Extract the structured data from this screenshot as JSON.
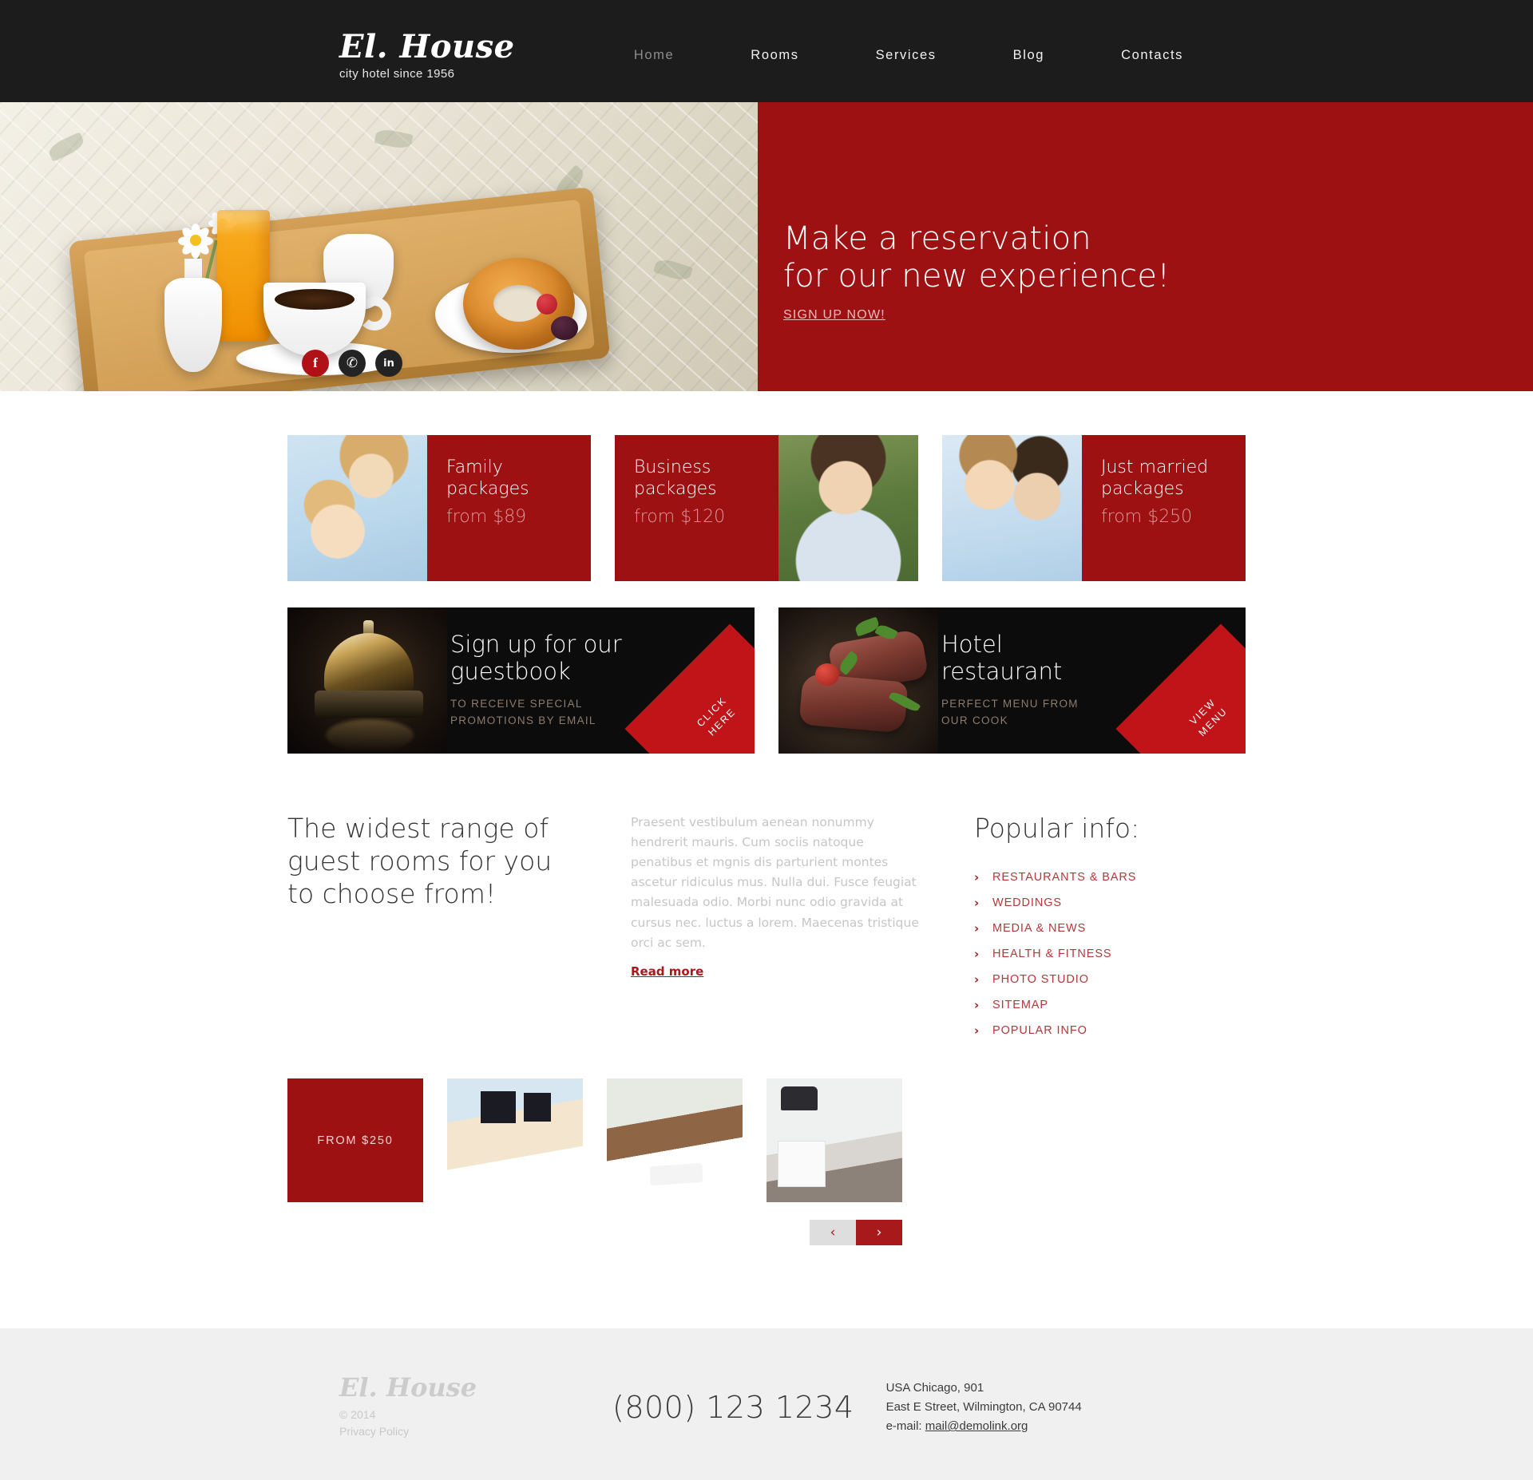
{
  "header": {
    "logo_mark": "El. House",
    "logo_tagline": "city hotel since 1956",
    "nav": [
      {
        "label": "Home",
        "active": true
      },
      {
        "label": "Rooms",
        "active": false
      },
      {
        "label": "Services",
        "active": false
      },
      {
        "label": "Blog",
        "active": false
      },
      {
        "label": "Contacts",
        "active": false
      }
    ]
  },
  "hero": {
    "title_line1": "Make a reservation",
    "title_line2": "for our new experience!",
    "cta": "SIGN UP NOW!",
    "dots": 3,
    "active_dot": 1,
    "accent_color": "#9e1113",
    "social": [
      {
        "name": "facebook",
        "glyph": "f"
      },
      {
        "name": "twitter",
        "glyph": "✆"
      },
      {
        "name": "linkedin",
        "glyph": "in"
      }
    ]
  },
  "packages": [
    {
      "name_line1": "Family",
      "name_line2": "packages",
      "price": "from $89",
      "photo": "mother-and-child"
    },
    {
      "name_line1": "Business",
      "name_line2": "packages",
      "price": "from $120",
      "photo": "smiling-businessman"
    },
    {
      "name_line1": "Just married",
      "name_line2": "packages",
      "price": "from $250",
      "photo": "newlywed-couple"
    }
  ],
  "promos": [
    {
      "title_line1": "Sign up for our",
      "title_line2": "guestbook",
      "sub_line1": "TO RECEIVE SPECIAL",
      "sub_line2": "PROMOTIONS BY EMAIL",
      "ribbon_line1": "CLICK",
      "ribbon_line2": "HERE",
      "photo": "service-bell"
    },
    {
      "title_line1": "Hotel",
      "title_line2": "restaurant",
      "sub_line1": "PERFECT MENU FROM",
      "sub_line2": "OUR COOK",
      "ribbon_line1": "VIEW",
      "ribbon_line2": "MENU",
      "photo": "grilled-steak"
    }
  ],
  "main": {
    "heading_line1": "The widest range of",
    "heading_line2": "guest rooms for you",
    "heading_line3": "to choose from!",
    "paragraph": "Praesent vestibulum aenean nonummy hendrerit mauris. Cum sociis natoque penatibus et mgnis dis parturient montes ascetur ridiculus mus. Nulla dui. Fusce feugiat malesuada odio. Morbi nunc odio gravida at cursus nec. luctus a lorem. Maecenas tristique orci ac sem.",
    "read_more": "Read more",
    "price_tile": "FROM $250",
    "gallery": [
      {
        "photo": "room-dark-headboard"
      },
      {
        "photo": "room-white-linens"
      },
      {
        "photo": "room-lamp-nightstand"
      }
    ],
    "pager": {
      "prev": "‹",
      "next": "›"
    }
  },
  "popular": {
    "title": "Popular info:",
    "items": [
      "RESTAURANTS & BARS",
      "WEDDINGS",
      "MEDIA & NEWS",
      "HEALTH & FITNESS",
      "PHOTO STUDIO",
      "SITEMAP",
      "POPULAR INFO"
    ]
  },
  "footer": {
    "logo_mark": "El. House",
    "copyright": "© 2014",
    "privacy": "Privacy Policy",
    "phone": "(800) 123 1234",
    "address_line1": "USA  Chicago, 901",
    "address_line2": "East E Street, Wilmington, CA 90744",
    "email_label": "e-mail: ",
    "email": "mail@demolink.org"
  }
}
